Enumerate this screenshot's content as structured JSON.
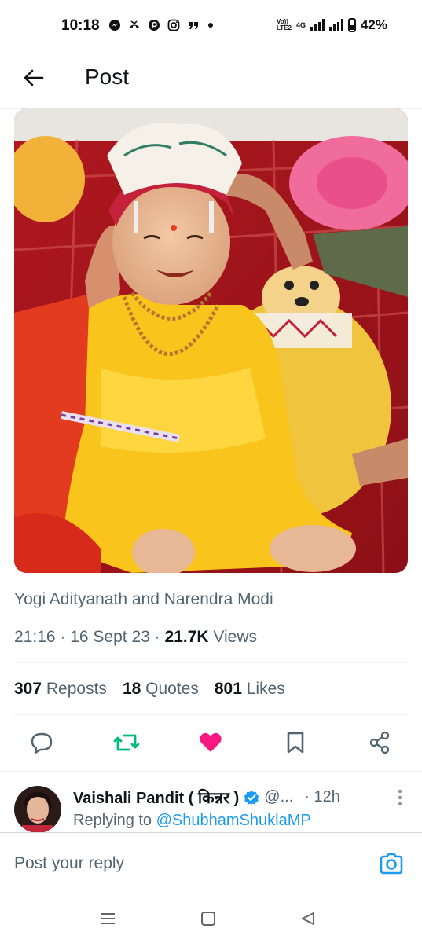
{
  "status_bar": {
    "time": "10:18",
    "battery": "42%",
    "network": "4G",
    "volte_top": "Vo))",
    "volte_bottom": "LTE2",
    "notification_icons": [
      "messenger-icon",
      "missed-call-icon",
      "picsart-icon",
      "instagram-icon",
      "quote-icon",
      "more-dot-icon"
    ]
  },
  "header": {
    "title": "Post"
  },
  "post": {
    "caption": "Yogi Adityanath and Narendra Modi",
    "time": "21:16",
    "date": "16 Sept 23",
    "views_count": "21.7K",
    "views_label": "Views",
    "reposts_count": "307",
    "reposts_label": "Reposts",
    "quotes_count": "18",
    "quotes_label": "Quotes",
    "likes_count": "801",
    "likes_label": "Likes",
    "liked": true,
    "colors": {
      "repost_green": "#00ba7c",
      "like_pink": "#f91880",
      "icon_gray": "#536471"
    }
  },
  "reply": {
    "name": "Vaishali Pandit ( किन्नर )",
    "handle": "@...",
    "time": "· 12h",
    "replying_prefix": "Replying to",
    "replying_to": "@ShubhamShuklaMP",
    "verified_color": "#1d9bf0"
  },
  "composer": {
    "placeholder": "Post your reply"
  }
}
